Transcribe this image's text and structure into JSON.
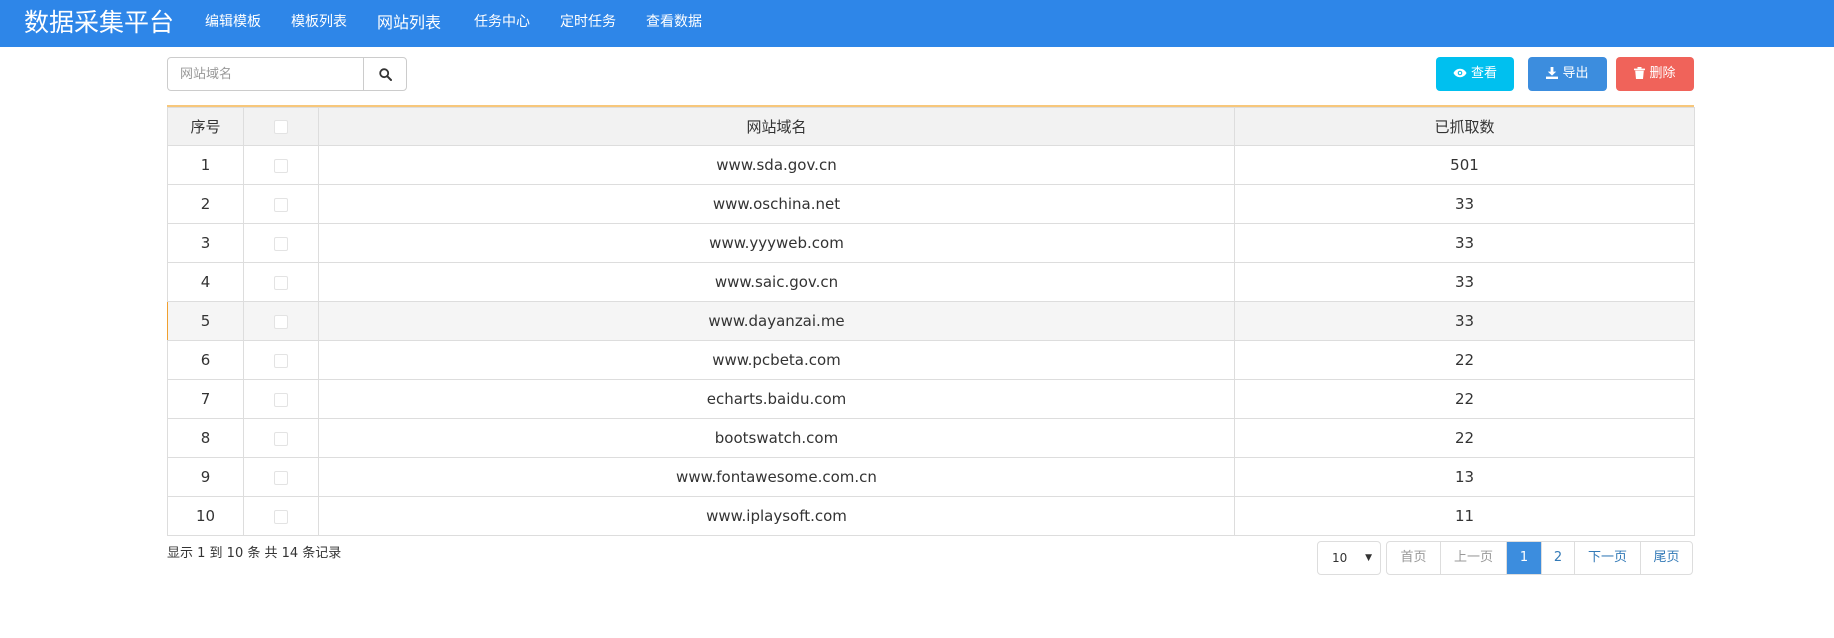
{
  "app": {
    "title": "数据采集平台"
  },
  "nav": {
    "items": [
      {
        "label": "编辑模板"
      },
      {
        "label": "模板列表"
      },
      {
        "label": "网站列表"
      },
      {
        "label": "任务中心"
      },
      {
        "label": "定时任务"
      },
      {
        "label": "查看数据"
      }
    ]
  },
  "search": {
    "placeholder": "网站域名",
    "value": ""
  },
  "toolbar": {
    "view_label": "查看",
    "export_label": "导出",
    "delete_label": "删除"
  },
  "table": {
    "headers": {
      "index": "序号",
      "domain": "网站域名",
      "count": "已抓取数"
    },
    "rows": [
      {
        "index": "1",
        "domain": "www.sda.gov.cn",
        "count": "501"
      },
      {
        "index": "2",
        "domain": "www.oschina.net",
        "count": "33"
      },
      {
        "index": "3",
        "domain": "www.yyyweb.com",
        "count": "33"
      },
      {
        "index": "4",
        "domain": "www.saic.gov.cn",
        "count": "33"
      },
      {
        "index": "5",
        "domain": "www.dayanzai.me",
        "count": "33"
      },
      {
        "index": "6",
        "domain": "www.pcbeta.com",
        "count": "22"
      },
      {
        "index": "7",
        "domain": "echarts.baidu.com",
        "count": "22"
      },
      {
        "index": "8",
        "domain": "bootswatch.com",
        "count": "22"
      },
      {
        "index": "9",
        "domain": "www.fontawesome.com.cn",
        "count": "13"
      },
      {
        "index": "10",
        "domain": "www.iplaysoft.com",
        "count": "11"
      }
    ]
  },
  "footer": {
    "summary": "显示 1 到 10 条 共 14 条记录",
    "page_size": "10",
    "pager": {
      "first": "首页",
      "prev": "上一页",
      "pages": [
        "1",
        "2"
      ],
      "current_page": "1",
      "next": "下一页",
      "last": "尾页"
    }
  },
  "colors": {
    "navbar": "#2e86e8",
    "view": "#00c0ef",
    "export": "#3c8dde",
    "delete": "#f0635a",
    "table_top_border": "#f7c77b",
    "active_page": "#3c8dde"
  },
  "icons": {
    "search": "search-icon",
    "view": "eye-icon",
    "export": "download-icon",
    "delete": "trash-icon",
    "page_size": "caret-down-icon"
  }
}
